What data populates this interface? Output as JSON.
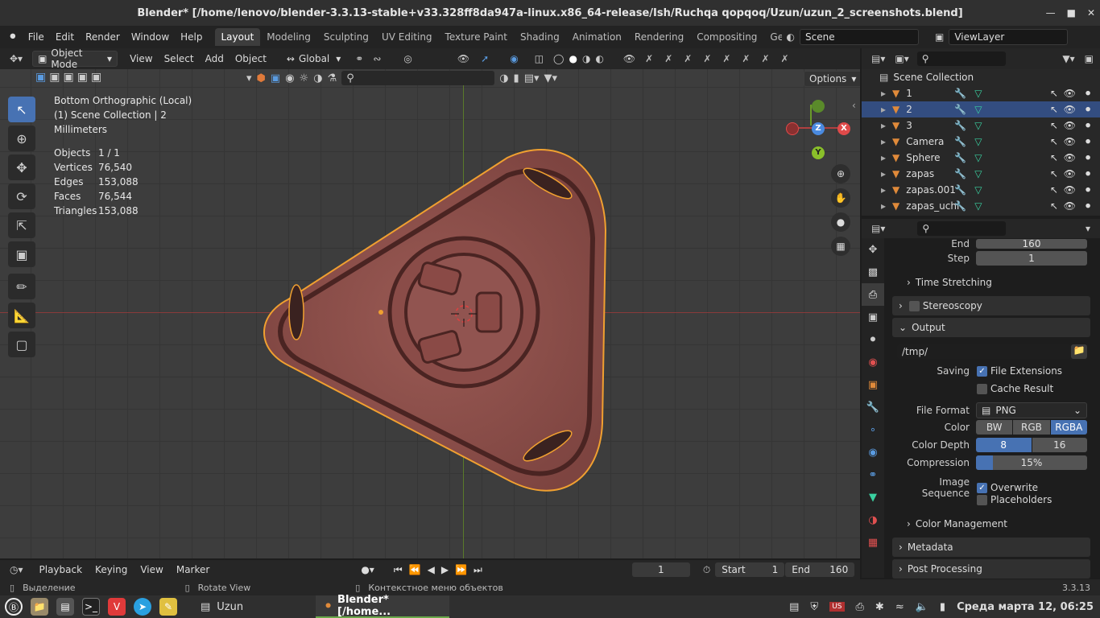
{
  "window": {
    "title": "Blender* [/home/lenovo/blender-3.3.13-stable+v33.328ff8da947a-linux.x86_64-release/Ish/Ruchqa qopqoq/Uzun/uzun_2_screenshots.blend]"
  },
  "menu": [
    "File",
    "Edit",
    "Render",
    "Window",
    "Help"
  ],
  "workspaces": [
    "Layout",
    "Modeling",
    "Sculpting",
    "UV Editing",
    "Texture Paint",
    "Shading",
    "Animation",
    "Rendering",
    "Compositing",
    "Geometry Noc"
  ],
  "scene": {
    "scene_name": "Scene",
    "view_layer": "ViewLayer"
  },
  "viewport_header": {
    "mode": "Object Mode",
    "menus": [
      "View",
      "Select",
      "Add",
      "Object"
    ],
    "orientation": "Global",
    "options": "Options"
  },
  "overlay": {
    "view_name": "Bottom Orthographic (Local)",
    "collection": "(1) Scene Collection | 2",
    "units": "Millimeters",
    "stats": [
      {
        "label": "Objects",
        "value": "1 / 1"
      },
      {
        "label": "Vertices",
        "value": "76,540"
      },
      {
        "label": "Edges",
        "value": "153,088"
      },
      {
        "label": "Faces",
        "value": "76,544"
      },
      {
        "label": "Triangles",
        "value": "153,088"
      }
    ]
  },
  "gizmo": {
    "z": "Z",
    "x": "X",
    "y": "Y"
  },
  "outliner": {
    "root": "Scene Collection",
    "items": [
      {
        "name": "1",
        "selected": false
      },
      {
        "name": "2",
        "selected": true
      },
      {
        "name": "3",
        "selected": false
      },
      {
        "name": "Camera",
        "selected": false
      },
      {
        "name": "Sphere",
        "selected": false
      },
      {
        "name": "zapas",
        "selected": false
      },
      {
        "name": "zapas.001",
        "selected": false
      },
      {
        "name": "zapas_uchi",
        "selected": false
      }
    ]
  },
  "properties": {
    "end_label": "End",
    "end_value": "160",
    "step_label": "Step",
    "step_value": "1",
    "time_stretching": "Time Stretching",
    "stereoscopy": "Stereoscopy",
    "output": "Output",
    "path": "/tmp/",
    "saving_label": "Saving",
    "file_extensions": "File Extensions",
    "cache_result": "Cache Result",
    "file_format_label": "File Format",
    "file_format": "PNG",
    "color_label": "Color",
    "color_opts": [
      "BW",
      "RGB",
      "RGBA"
    ],
    "color_depth_label": "Color Depth",
    "depth_opts": [
      "8",
      "16"
    ],
    "compression_label": "Compression",
    "compression": "15%",
    "compression_fraction": 0.15,
    "image_sequence_label": "Image Sequence",
    "overwrite": "Overwrite",
    "placeholders": "Placeholders",
    "color_management": "Color Management",
    "metadata": "Metadata",
    "post_processing": "Post Processing"
  },
  "timeline": {
    "menus": [
      "Playback",
      "Keying",
      "View",
      "Marker"
    ],
    "frame": "1",
    "start_label": "Start",
    "start": "1",
    "end_label": "End",
    "end": "160"
  },
  "statusbar": {
    "left": "Выделение",
    "mid": "Rotate View",
    "right": "Контекстное меню объектов",
    "version": "3.3.13"
  },
  "taskbar": {
    "folder": "Uzun",
    "blender": "Blender* [/home...",
    "clock": "Среда марта 12, 06:25"
  }
}
